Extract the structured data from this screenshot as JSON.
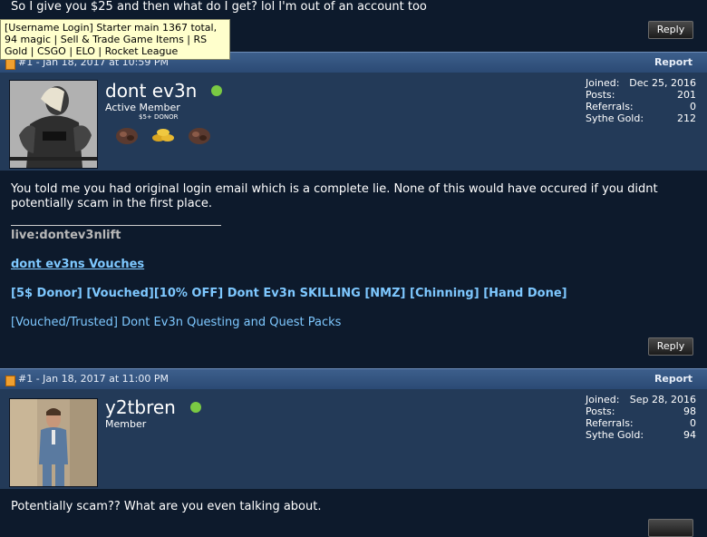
{
  "top": {
    "text": "So I give you $25 and then what do I get? lol I'm out of an account too",
    "reply_label": "Reply"
  },
  "tooltip": {
    "text": "[Username Login] Starter main 1367 total, 94 magic | Sell & Trade Game Items | RS Gold | CSGO | ELO | Rocket League"
  },
  "posts": [
    {
      "post_id": "#1 - Jan 18, 2017 at 10:59 PM",
      "report_label": "Report",
      "username": "dont ev3n",
      "user_title": "Active Member",
      "donor_label": "$5+ DONOR",
      "online_color": "#7ac943",
      "stats": [
        {
          "label": "Joined:",
          "value": "Dec 25, 2016"
        },
        {
          "label": "Posts:",
          "value": "201"
        },
        {
          "label": "Referrals:",
          "value": "0"
        },
        {
          "label": "Sythe Gold:",
          "value": "212"
        }
      ],
      "message": "You told me you had original login email which is a complete lie. None of this would have occured if you didnt potentially scam in the first place.",
      "signature": {
        "live": "live:dontev3nlift",
        "vouches": "dont ev3ns Vouches",
        "thread1": "[5$ Donor] [Vouched][10% OFF] Dont Ev3n SKILLING [NMZ] [Chinning] [Hand Done]",
        "thread2": "[Vouched/Trusted] Dont Ev3n Questing and Quest Packs"
      },
      "reply_label": "Reply"
    },
    {
      "post_id": "#1 - Jan 18, 2017 at 11:00 PM",
      "report_label": "Report",
      "username": "y2tbren",
      "user_title": "Member",
      "online_color": "#7ac943",
      "stats": [
        {
          "label": "Joined:",
          "value": "Sep 28, 2016"
        },
        {
          "label": "Posts:",
          "value": "98"
        },
        {
          "label": "Referrals:",
          "value": "0"
        },
        {
          "label": "Sythe Gold:",
          "value": "94"
        }
      ],
      "message": "Potentially scam?? What are you even talking about."
    }
  ]
}
